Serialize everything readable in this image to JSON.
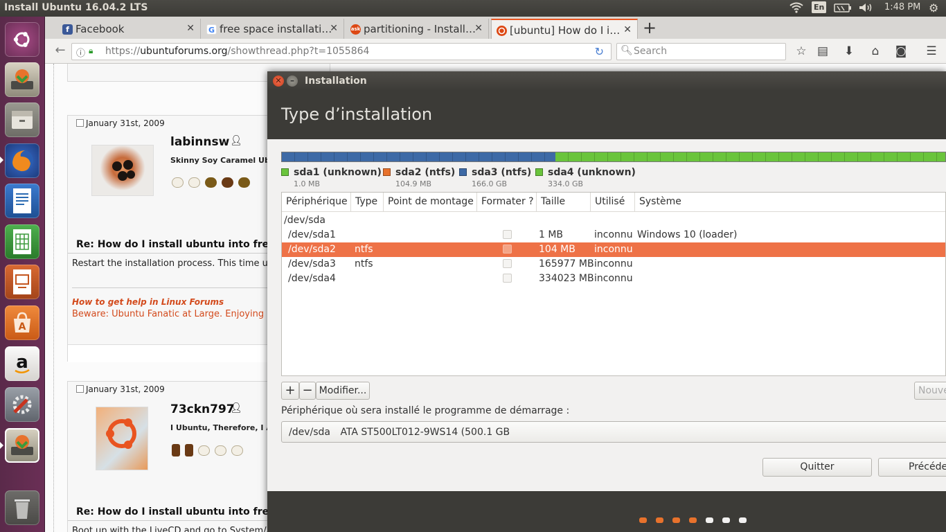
{
  "top_panel": {
    "title": "Install Ubuntu 16.04.2 LTS",
    "keyboard": "En",
    "time": "1:48 PM"
  },
  "launcher": {
    "items": [
      {
        "name": "dash-home",
        "color": "#8b3a6e"
      },
      {
        "name": "ubuntu-installer",
        "color": "#6e8f3a"
      },
      {
        "name": "files",
        "color": "#7a7a72"
      },
      {
        "name": "firefox",
        "color": "#e66000"
      },
      {
        "name": "libreoffice-writer",
        "color": "#2a6ab2"
      },
      {
        "name": "libreoffice-calc",
        "color": "#3c9a3c"
      },
      {
        "name": "libreoffice-impress",
        "color": "#c4561f"
      },
      {
        "name": "ubuntu-software",
        "color": "#e8722c"
      },
      {
        "name": "amazon",
        "color": "#e9e6e2"
      },
      {
        "name": "system-settings",
        "color": "#8a8d92"
      },
      {
        "name": "ubuntu-installer-running",
        "color": "#6e8f3a"
      },
      {
        "name": "trash",
        "color": "#6d6c69"
      }
    ]
  },
  "browser": {
    "tabs": [
      {
        "label": "Facebook",
        "favicon": "f",
        "color": "#3b5998"
      },
      {
        "label": "free space installati…",
        "favicon": "G",
        "color": "#4285f4"
      },
      {
        "label": "partitioning - Install…",
        "favicon": "ask",
        "color": "#dd4814"
      },
      {
        "label": "[ubuntu] How do I i…",
        "favicon": "ubuntu",
        "color": "#dd4814"
      }
    ],
    "url_scheme": "https://",
    "url_host": "ubuntuforums.org",
    "url_path": "/showthread.php?t=1055864",
    "search_placeholder": "Search"
  },
  "forum": {
    "posts": [
      {
        "date": "January 31st, 2009",
        "username": "labinnsw",
        "user_title": "Skinny Soy Caramel Ubuntu",
        "title": "Re: How do I install ubuntu into free space",
        "body": "Restart the installation process. This time use ma",
        "sig_link": "How to get help in Linux Forums",
        "sig_text": "Beware: Ubuntu Fanatic at Large. Enjoying Ubunt"
      },
      {
        "date": "January 31st, 2009",
        "username": "73ckn797",
        "user_title": "I Ubuntu, Therefore, I Am",
        "title": "Re: How do I install ubuntu into free space",
        "body": "Boot up with the LiveCD and go to System/Admi"
      }
    ]
  },
  "installer": {
    "window_title": "Installation",
    "heading": "Type d’installation",
    "partitions": [
      {
        "name": "sda1 (unknown)",
        "size": "1.0 MB",
        "color": "#6ac43c"
      },
      {
        "name": "sda2 (ntfs)",
        "size": "104.9 MB",
        "color": "#e8722c"
      },
      {
        "name": "sda3 (ntfs)",
        "size": "166.0 GB",
        "color": "#3e6aa6"
      },
      {
        "name": "sda4 (unknown)",
        "size": "334.0 GB",
        "color": "#6ac43c"
      }
    ],
    "columns": [
      "Périphérique",
      "Type",
      "Point de montage",
      "Formater ?",
      "Taille",
      "Utilisé",
      "Système"
    ],
    "rows": [
      {
        "device": "/dev/sda",
        "type": "",
        "mount": "",
        "format": false,
        "size": "",
        "used": "",
        "system": "",
        "is_disk": true
      },
      {
        "device": "/dev/sda1",
        "type": "",
        "mount": "",
        "format": false,
        "size": "1 MB",
        "used": "inconnu",
        "system": "Windows 10 (loader)"
      },
      {
        "device": "/dev/sda2",
        "type": "ntfs",
        "mount": "",
        "format": false,
        "size": "104 MB",
        "used": "inconnu",
        "system": "",
        "selected": true
      },
      {
        "device": "/dev/sda3",
        "type": "ntfs",
        "mount": "",
        "format": false,
        "size": "165977 MB",
        "used": "inconnu",
        "system": ""
      },
      {
        "device": "/dev/sda4",
        "type": "",
        "mount": "",
        "format": false,
        "size": "334023 MB",
        "used": "inconnu",
        "system": ""
      }
    ],
    "add_label": "+",
    "remove_label": "−",
    "modify_label": "Modifier...",
    "new_table_label": "Nouve",
    "boot_label": "Périphérique où sera installé le programme de démarrage :",
    "boot_device": "/dev/sda",
    "boot_desc": "ATA ST500LT012-9WS14 (500.1 GB",
    "quit_label": "Quitter",
    "back_label": "Précéde",
    "progress": {
      "total": 7,
      "done": 4
    }
  }
}
